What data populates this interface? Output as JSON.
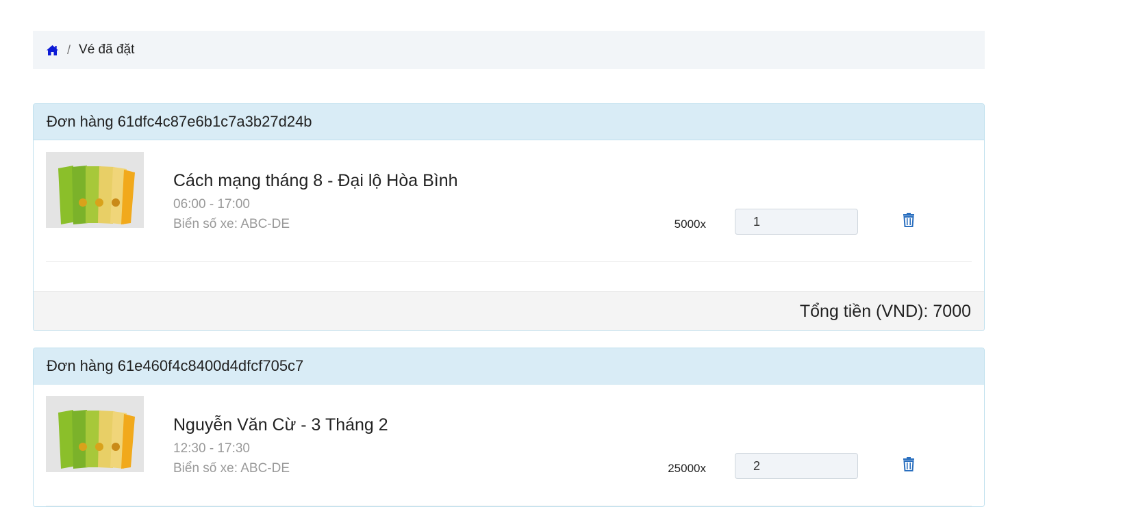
{
  "breadcrumb": {
    "home_icon": "home-icon",
    "separator": "/",
    "current": "Vé đã đặt",
    "icon_color": "#0d1bd6"
  },
  "orders": [
    {
      "title": "Đơn hàng 61dfc4c87e6b1c7a3b27d24b",
      "items": [
        {
          "image": "parking-tickets-thumbnail",
          "name": "Cách mạng tháng 8 - Đại lộ Hòa Bình",
          "time": "06:00 - 17:00",
          "plate": "Biển số xe: ABC-DE",
          "price": "5000x",
          "quantity": "1"
        }
      ],
      "total": "Tổng tiền (VND): 7000"
    },
    {
      "title": "Đơn hàng 61e460f4c8400d4dfcf705c7",
      "items": [
        {
          "image": "parking-tickets-thumbnail",
          "name": "Nguyễn Văn Cừ - 3 Tháng 2",
          "time": "12:30 - 17:30",
          "plate": "Biển số xe: ABC-DE",
          "price": "25000x",
          "quantity": "2"
        }
      ]
    }
  ],
  "colors": {
    "order_header_bg": "#d9ecf6",
    "trash_icon": "#2a6fbf"
  }
}
